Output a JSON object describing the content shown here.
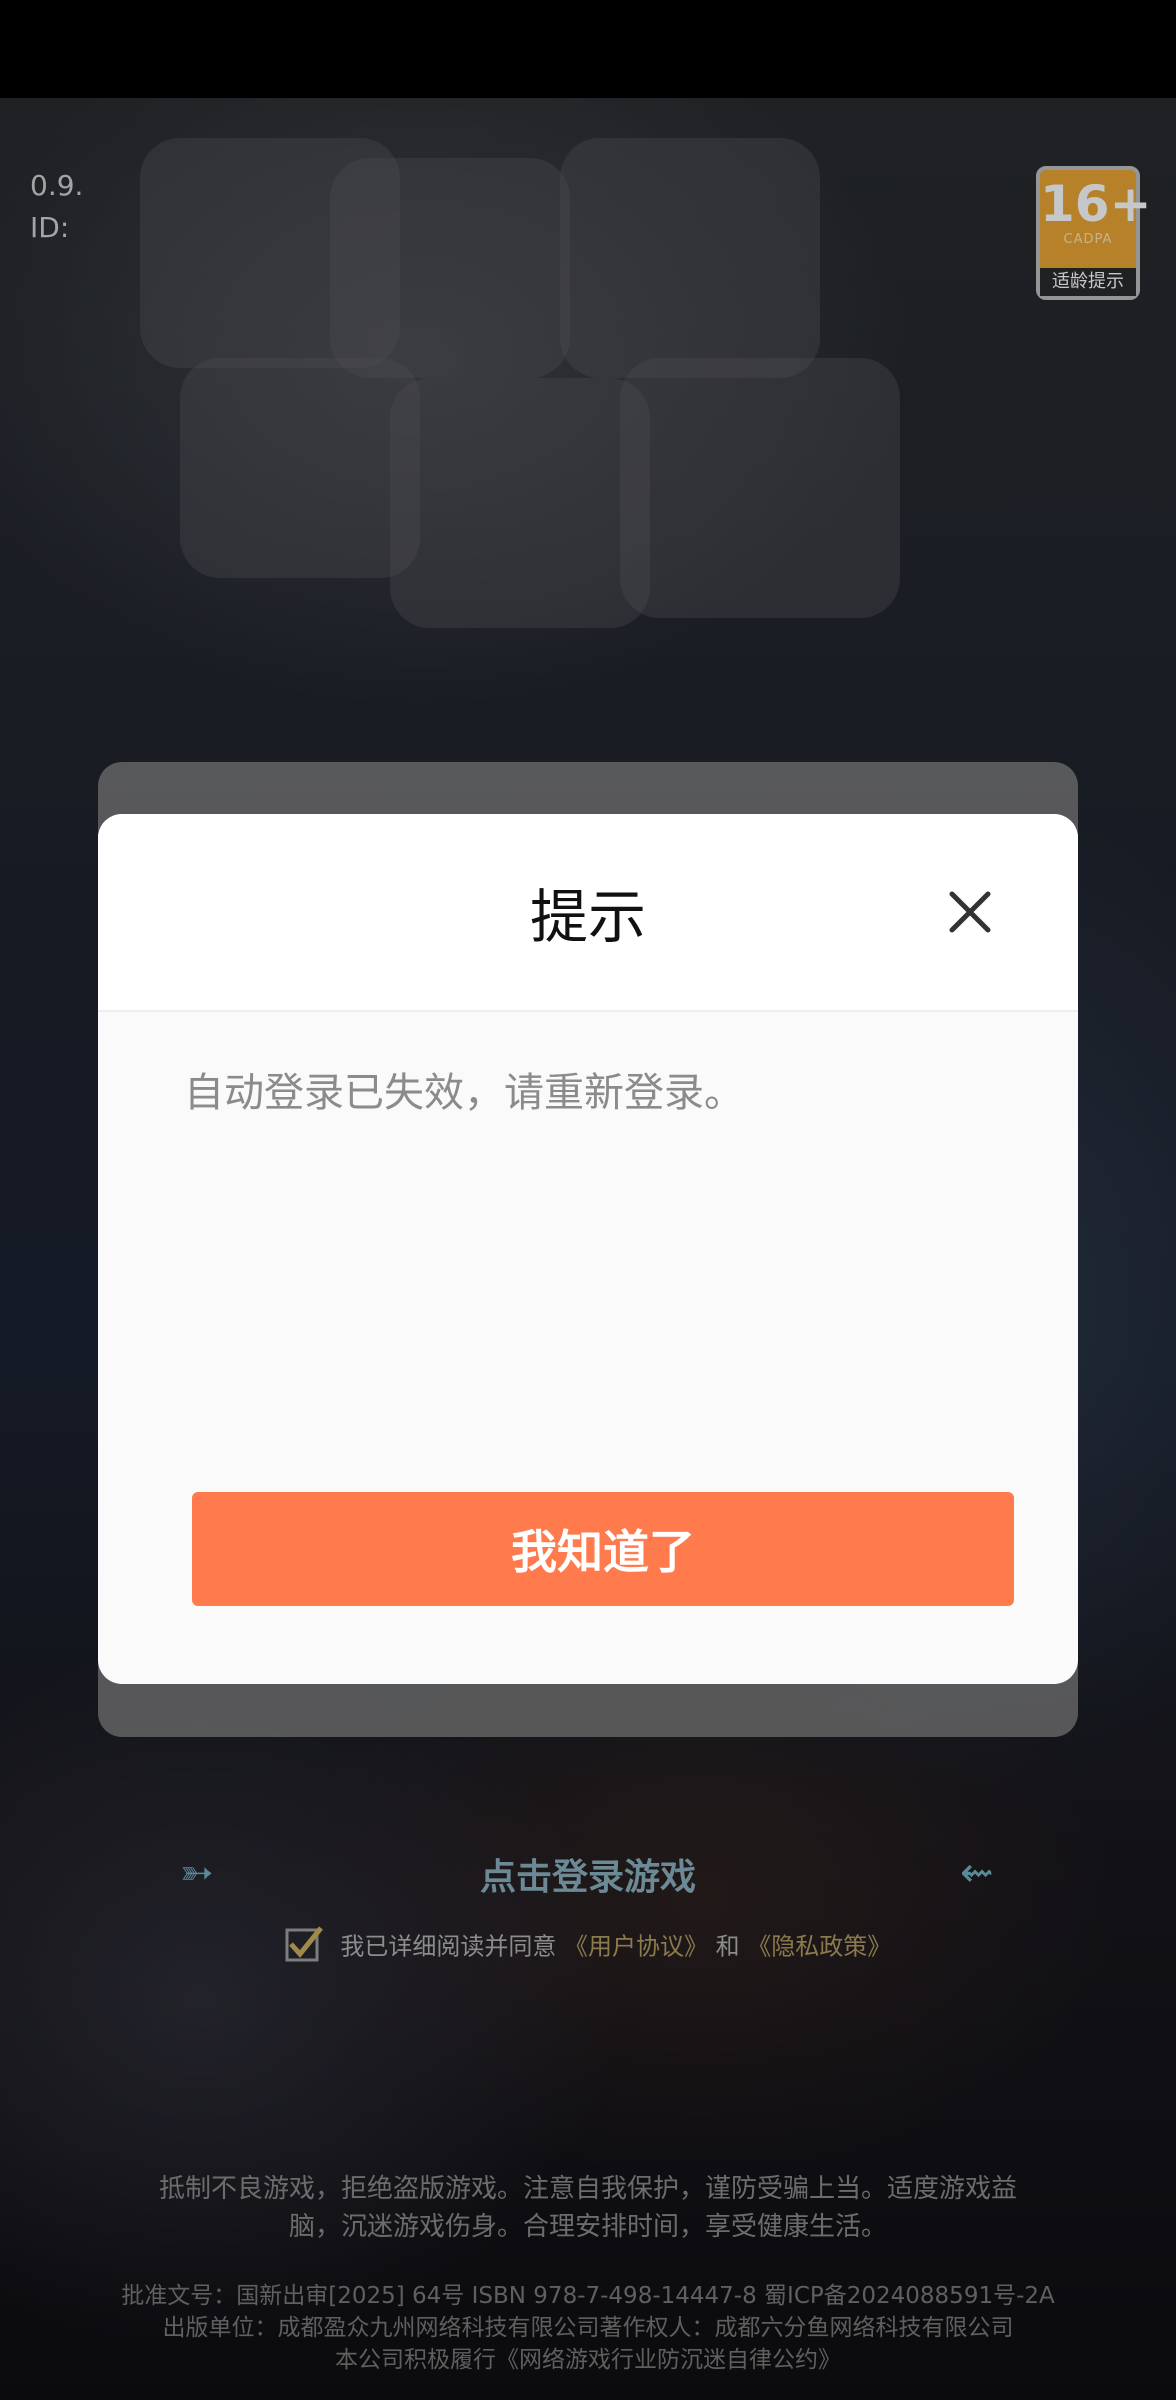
{
  "status_bar": {},
  "background": {
    "version_line1": "0.9.",
    "version_line2": "ID:",
    "age_rating": {
      "age": "16+",
      "org": "CADPA",
      "tip": "适龄提示"
    },
    "login_prompt": "点击登录游戏",
    "agreement": {
      "prefix": "我已详细阅读并同意",
      "user_agreement": "《用户协议》",
      "and": "和",
      "privacy_policy": "《隐私政策》"
    },
    "health_notice_line1": "抵制不良游戏，拒绝盗版游戏。注意自我保护，谨防受骗上当。适度游戏益",
    "health_notice_line2": "脑，沉迷游戏伤身。合理安排时间，享受健康生活。",
    "legal_line1": "批准文号：国新出审[2025] 64号 ISBN 978-7-498-14447-8 蜀ICP备2024088591号-2A",
    "legal_line2": "出版单位：成都盈众九州网络科技有限公司著作权人：成都六分鱼网络科技有限公司",
    "legal_line3": "本公司积极履行《网络游戏行业防沉迷自律公约》"
  },
  "dialog": {
    "title": "提示",
    "message": "自动登录已失效，请重新登录。",
    "confirm_label": "我知道了",
    "accent_color": "#ff7a4d"
  },
  "icons": {
    "close": "close-icon",
    "checkbox": "check-icon",
    "arrow_left": "arrow-left-icon",
    "arrow_right": "arrow-right-icon"
  }
}
